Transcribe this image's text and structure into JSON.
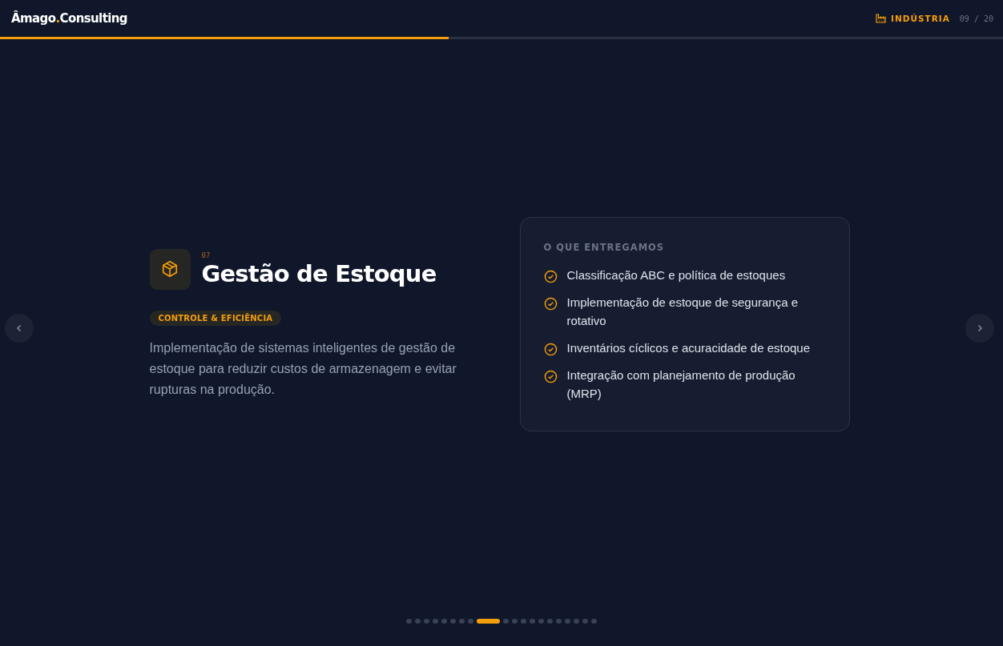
{
  "header": {
    "logo": {
      "name": "Âmago",
      "dot": ".",
      "suffix": "Consulting"
    },
    "section": "INDÚSTRIA",
    "counter": "09 / 20",
    "progress": {
      "level": 0.447
    }
  },
  "slide": {
    "number": "07",
    "title": "Gestão de Estoque",
    "tag": "CONTROLE & EFICIÊNCIA",
    "description": "Implementação de sistemas inteligentes de gestão de estoque para reduzir custos de armazenagem e evitar rupturas na produção.",
    "deliverables": {
      "heading": "O QUE ENTREGAMOS",
      "items": [
        {
          "text": "Classificação ABC e política de estoques"
        },
        {
          "text": "Implementação de estoque de segurança e rotativo"
        },
        {
          "text": "Inventários cíclicos e acuracidade de estoque"
        },
        {
          "text": "Integração com planejamento de produção (MRP)"
        }
      ]
    }
  },
  "pagination": [
    {
      "selected": false
    },
    {
      "selected": false
    },
    {
      "selected": false
    },
    {
      "selected": false
    },
    {
      "selected": false
    },
    {
      "selected": false
    },
    {
      "selected": false
    },
    {
      "selected": false
    },
    {
      "selected": true
    },
    {
      "selected": false
    },
    {
      "selected": false
    },
    {
      "selected": false
    },
    {
      "selected": false
    },
    {
      "selected": false
    },
    {
      "selected": false
    },
    {
      "selected": false
    },
    {
      "selected": false
    },
    {
      "selected": false
    },
    {
      "selected": false
    },
    {
      "selected": false
    }
  ]
}
